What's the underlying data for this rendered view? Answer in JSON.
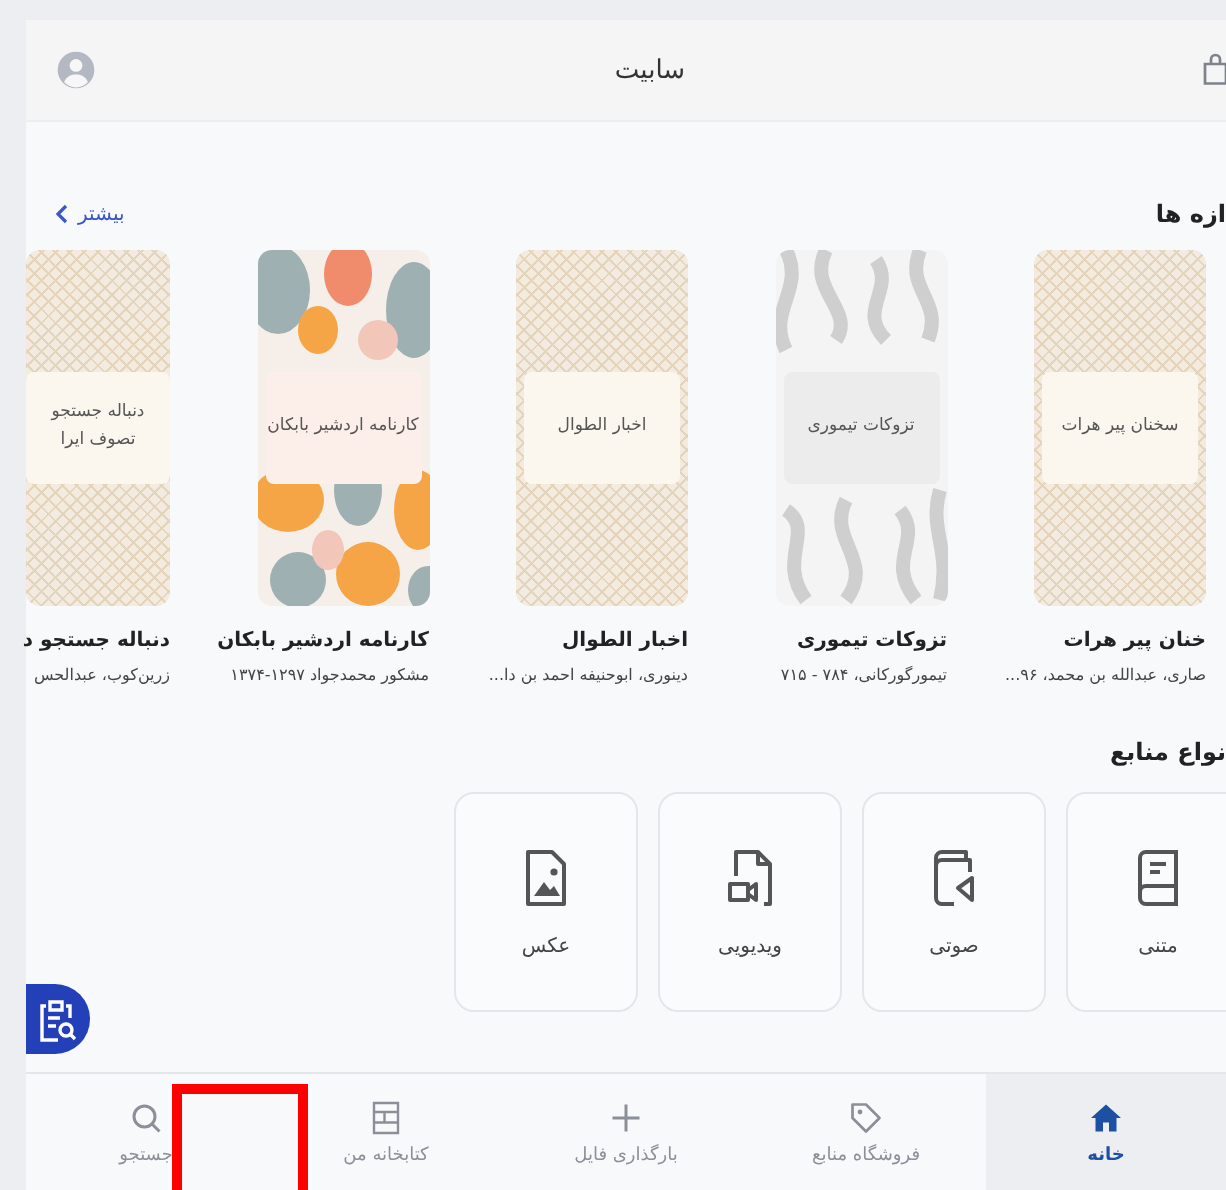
{
  "header": {
    "title": "سابیت"
  },
  "new_section": {
    "title": "ازه ها",
    "more_link": "بیشتر"
  },
  "books": [
    {
      "cover_text": "سخنان پیر هرات",
      "kind": "pattern",
      "title": "خنان پیر هرات",
      "author": "صاری، عبدالله بن محمد، ۹۶..."
    },
    {
      "cover_text": "تزوکات تیموری",
      "kind": "swirl",
      "title": "تزوکات تیموری",
      "author": "تیمورگورکانی، ۷۸۴ - ۷۱۵"
    },
    {
      "cover_text": "اخبار الطوال",
      "kind": "pattern",
      "title": "اخبار الطوال",
      "author": "دینوری، ابوحنیفه احمد بن دا..."
    },
    {
      "cover_text": "کارنامه اردشیر بابکان",
      "kind": "blobs",
      "title": "کارنامه اردشیر بابکان",
      "author": "مشکور محمدجواد ۱۲۹۷-۱۳۷۴"
    },
    {
      "cover_text": "دنباله جستجو\nتصوف ایرا",
      "kind": "pattern",
      "title": "دنباله جستجو د",
      "author": "زرین‌کوب، عبدالحس"
    }
  ],
  "resource_types": {
    "title": "نواع منابع",
    "items": [
      {
        "label": "متنی",
        "kind": "book"
      },
      {
        "label": "صوتی",
        "kind": "audio"
      },
      {
        "label": "ویدیویی",
        "kind": "video"
      },
      {
        "label": "عکس",
        "kind": "image"
      }
    ]
  },
  "bottom_nav": [
    {
      "label": "خانه",
      "kind": "home",
      "selected": true
    },
    {
      "label": "فروشگاه منابع",
      "kind": "tag",
      "selected": false
    },
    {
      "label": "بارگذاری فایل",
      "kind": "plus",
      "selected": false
    },
    {
      "label": "کتابخانه من",
      "kind": "shelf",
      "selected": false
    },
    {
      "label": "جستجو",
      "kind": "search",
      "selected": false
    }
  ]
}
